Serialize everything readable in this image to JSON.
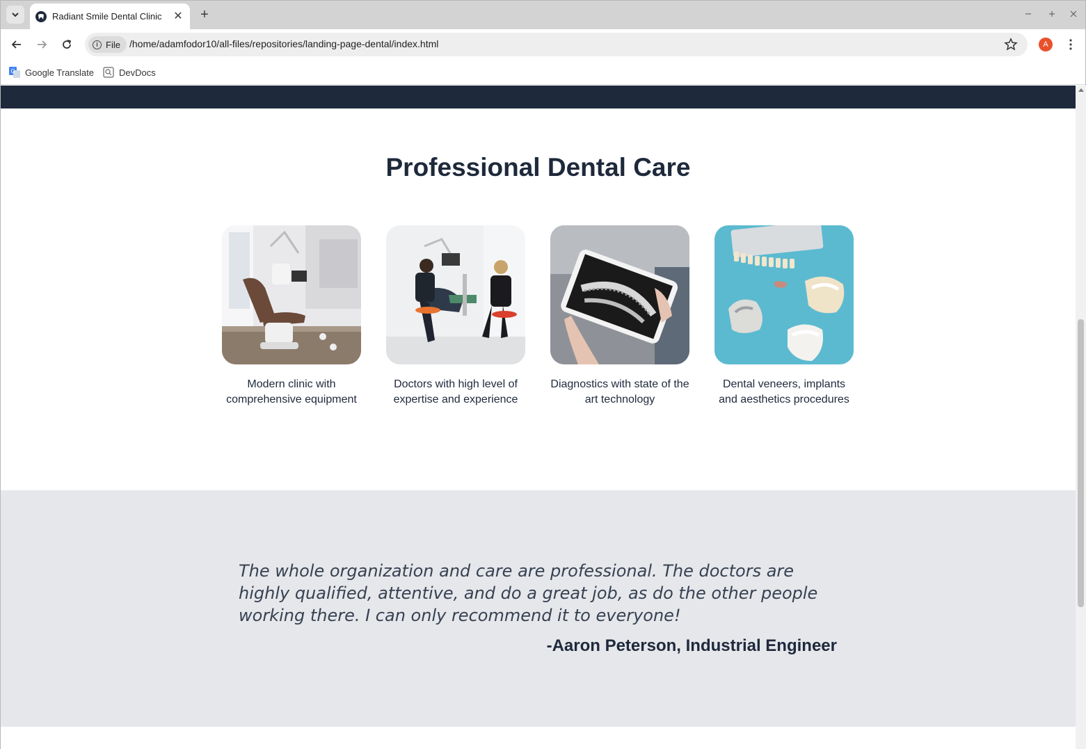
{
  "browser": {
    "tab_title": "Radiant Smile Dental Clinic",
    "new_tab_symbol": "+",
    "close_symbol": "✕",
    "chip_label": "File",
    "url": "/home/adamfodor10/all-files/repositories/landing-page-dental/index.html",
    "profile_initial": "A",
    "bookmarks": [
      {
        "label": "Google Translate",
        "icon": "google-translate-icon"
      },
      {
        "label": "DevDocs",
        "icon": "devdocs-icon"
      }
    ]
  },
  "page": {
    "colors": {
      "header": "#1e293b",
      "testimonial_bg": "#e5e7eb",
      "text": "#1e293b"
    },
    "features_title": "Professional Dental Care",
    "features": [
      {
        "caption": "Modern clinic with comprehensive equipment",
        "image": "dental-office-photo"
      },
      {
        "caption": "Doctors with high level of expertise and experience",
        "image": "dentists-working-photo"
      },
      {
        "caption": "Diagnostics with state of the art technology",
        "image": "xray-tablet-photo"
      },
      {
        "caption": "Dental veneers, implants and aesthetics procedures",
        "image": "dental-models-photo"
      }
    ],
    "testimonial": {
      "quote": "The whole organization and care are professional. The doctors are highly qualified, attentive, and do a great job, as do the other people working there. I can only recommend it to everyone!",
      "author": "-Aaron Peterson, Industrial Engineer"
    }
  }
}
